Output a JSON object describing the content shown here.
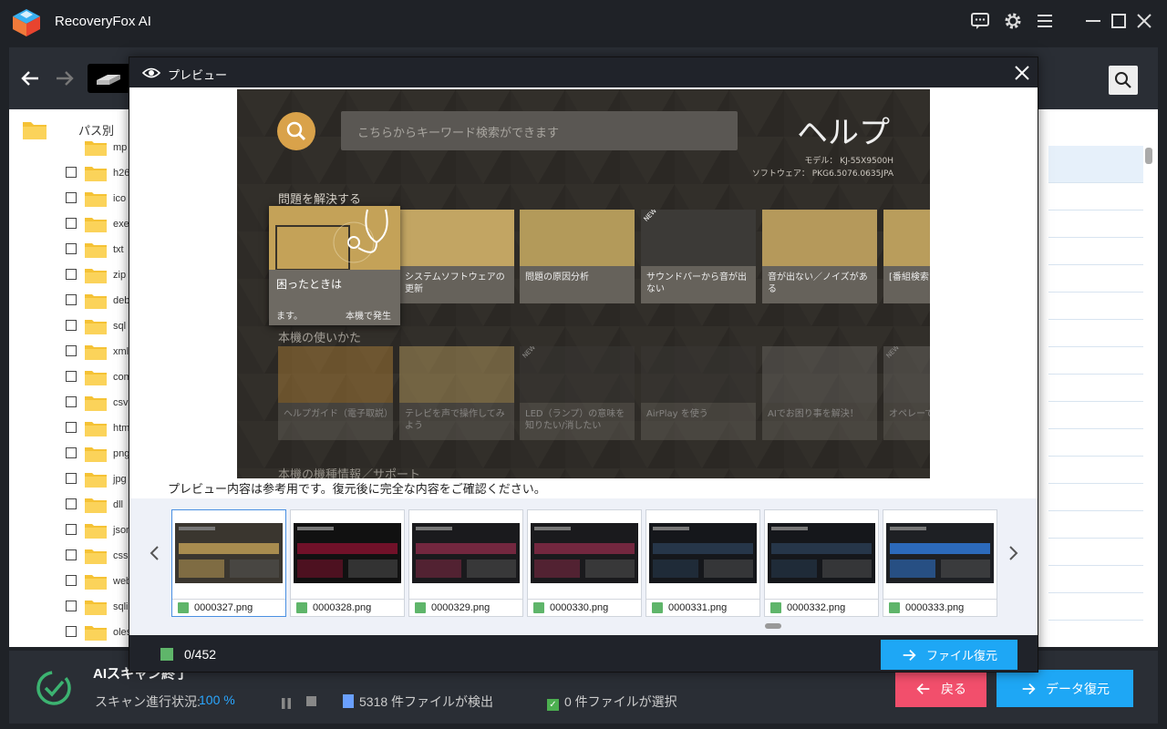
{
  "app": {
    "title": "RecoveryFox AI"
  },
  "titlebar": {
    "icons": [
      "feedback-icon",
      "settings-icon",
      "menu-icon",
      "minimize-icon",
      "maximize-icon",
      "close-icon"
    ]
  },
  "tree": {
    "header": "パス別",
    "items": [
      "mp",
      "h26",
      "ico",
      "exe",
      "txt",
      "zip",
      "deb",
      "sql",
      "xml",
      "com",
      "csv",
      "htm",
      "png",
      "jpg",
      "dll",
      "json",
      "css",
      "web",
      "sqli",
      "oles"
    ]
  },
  "preview": {
    "title": "プレビュー",
    "note": "プレビュー内容は参考用です。復元後に完全な内容をご確認ください。",
    "count": "0/452",
    "recover_button": "ファイル復元",
    "image": {
      "search_placeholder": "こちらからキーワード検索ができます",
      "help_title": "ヘルプ",
      "model_line": "モデル： KJ-55X9500H",
      "software_line": "ソフトウェア： PKG6.5076.0635JPA",
      "section1": "問題を解決する",
      "section2": "本機の使いかた",
      "section3": "本機の機種情報／サポート",
      "focus_tile": {
        "caption": "困ったときは",
        "sub1": "ます。",
        "sub2": "本機で発生"
      },
      "row1": [
        "システムソフトウェアの更新",
        "問題の原因分析",
        "サウンドバーから音が出ない",
        "音が出ない／ノイズがある",
        "[番組検索た"
      ],
      "row2": [
        "ヘルプガイド（電子取説）",
        "テレビを声で操作してみよう",
        "LED（ランプ）の意味を知りたい/消したい",
        "AirPlay を使う",
        "AIでお困り事を解決！",
        "オペレーで診断"
      ],
      "new_badge": "NEW"
    },
    "thumbnails": [
      {
        "name": "0000327.png"
      },
      {
        "name": "0000328.png"
      },
      {
        "name": "0000329.png"
      },
      {
        "name": "0000330.png"
      },
      {
        "name": "0000331.png"
      },
      {
        "name": "0000332.png"
      },
      {
        "name": "0000333.png"
      }
    ]
  },
  "status": {
    "title": "AIスキャン終了",
    "progress_label": "スキャン進行状況:",
    "progress_value": "100 %",
    "files_found": "5318 件ファイルが検出",
    "files_selected": "0 件ファイルが選択",
    "back_button": "戻る",
    "recover_button": "データ復元"
  },
  "colors": {
    "accent": "#1ea7f5",
    "back": "#f24f6c",
    "ok": "#3cb371",
    "folder": "#f5c235"
  }
}
